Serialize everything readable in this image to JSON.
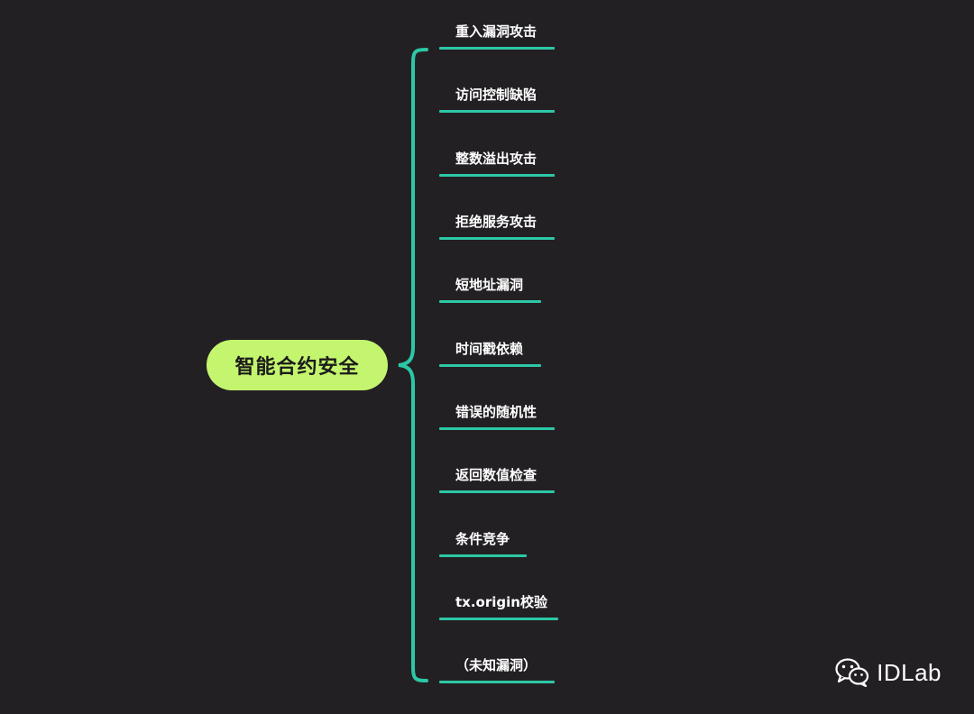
{
  "mindmap": {
    "root": "智能合约安全",
    "branches": [
      "重入漏洞攻击",
      "访问控制缺陷",
      "整数溢出攻击",
      "拒绝服务攻击",
      "短地址漏洞",
      "时间戳依赖",
      "错误的随机性",
      "返回数值检查",
      "条件竞争",
      "tx.origin校验",
      "（未知漏洞）"
    ]
  },
  "watermark": {
    "icon": "wechat-icon",
    "text": "IDLab"
  },
  "colors": {
    "background": "#232024",
    "root_fill": "#c3f56e",
    "connector": "#2cc8a6",
    "label": "#ffffff"
  }
}
